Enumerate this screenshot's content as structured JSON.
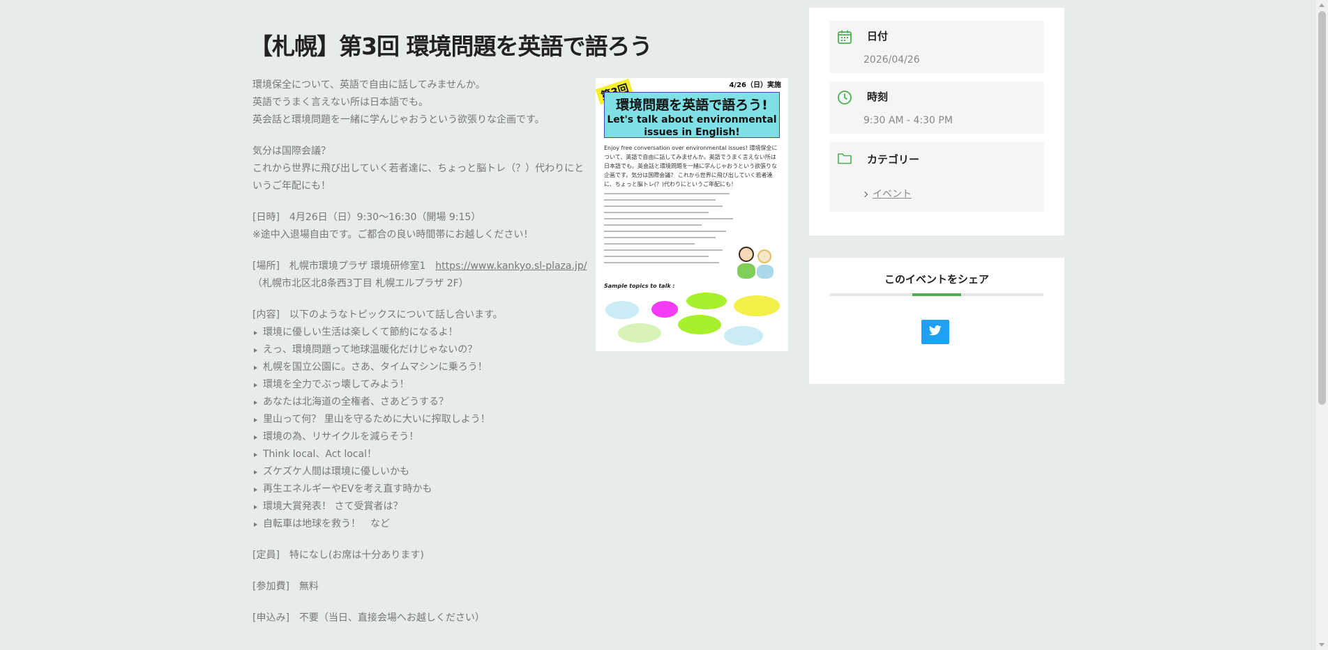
{
  "title": "【札幌】第3回 環境問題を英語で語ろう",
  "intro": [
    "環境保全について、英語で自由に話してみませんか。",
    "英語でうまく言えない所は日本語でも。",
    "英会話と環境問題を一緒に学んじゃおうという欲張りな企画です。"
  ],
  "mood": [
    "気分は国際会議？",
    "これから世界に飛び出していく若者達に、ちょっと脳トレ（？）代わりにというご年配にも！"
  ],
  "datetime": [
    "[日時]　4月26日（日）9:30〜16:30（開場 9:15）",
    "※途中入退場自由です。ご都合の良い時間帯にお越しください！"
  ],
  "place": {
    "label": "[場所]　札幌市環境プラザ 環境研修室1　",
    "url": "https://www.kankyo.sl-plaza.jp/",
    "address": "（札幌市北区北8条西3丁目 札幌エルプラザ 2F）"
  },
  "content_label": "[内容]　以下のようなトピックスについて話し合います。",
  "topics": [
    "環境に優しい生活は楽しくて節約になるよ！",
    "えっ、環境問題って地球温暖化だけじゃないの？",
    "札幌を国立公園に。さあ、タイムマシンに乗ろう！",
    "環境を全力でぶっ壊してみよう！",
    "あなたは北海道の全権者、さあどうする？",
    "里山って何？ 里山を守るために大いに搾取しよう！",
    "環境の為、リサイクルを減らそう！",
    "Think local、Act local！",
    "ズケズケ人間は環境に優しいかも",
    "再生エネルギーやEVを考え直す時かも",
    "環境大賞発表！ さて受賞者は？",
    "自転車は地球を救う！　など"
  ],
  "capacity": "[定員]　特になし(お席は十分あります)",
  "fee": "[参加費]　無料",
  "apply": "[申込み]　不要（当日、直接会場へお越しください）",
  "flyer": {
    "date": "4/26（日）実施",
    "badge": "第3回",
    "headline_jp": "環境問題を英語で語ろう!",
    "headline_en": "Let's talk about environmental issues in English!",
    "body": "Enjoy free conversation over environmental issues! 環境保全について、英語で自由に話してみませんか。英語でうまく言えない所は日本語でも。英会話と環境問題を一緒に学んじゃおうという欲張りな企画です。気分は国際会議？ これから世界に飛び出していく若者達に、ちょっと脳トレ(？)代わりにというご年配にも！",
    "sample": "Sample topics to talk :"
  },
  "sidebar": {
    "date_label": "日付",
    "date_value": "2026/04/26",
    "time_label": "時刻",
    "time_value": "9:30 AM - 4:30 PM",
    "category_label": "カテゴリー",
    "category_value": "イベント",
    "share_title": "このイベントをシェア"
  },
  "colors": {
    "accent": "#4caf50",
    "twitter": "#1da1f2",
    "background": "#e8ece8"
  }
}
